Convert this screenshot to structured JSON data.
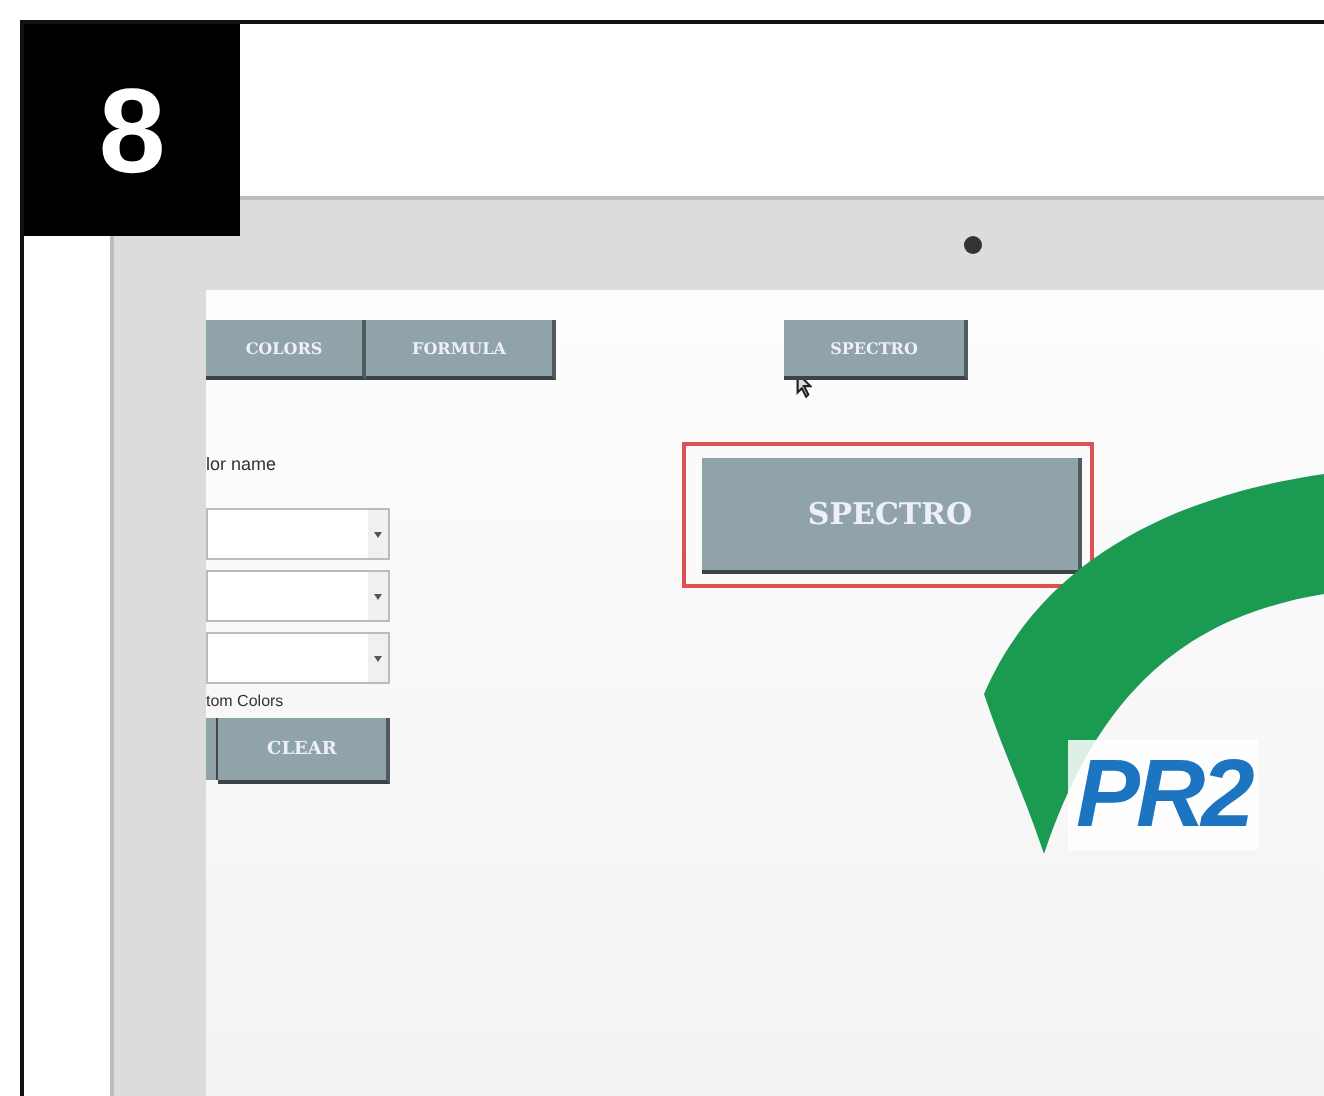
{
  "step_badge": "8",
  "tabs": [
    {
      "label": "COLORS"
    },
    {
      "label": "FORMULA"
    }
  ],
  "top_button": "SPECTRO",
  "color_name_label": "lor name",
  "dropdowns": [
    {
      "kind": "select"
    },
    {
      "kind": "select"
    },
    {
      "kind": "select"
    }
  ],
  "custom_colors_label": "tom Colors",
  "clear_button": "CLEAR",
  "spectro_button": {
    "label": "SPECTRO",
    "highlighted": true
  },
  "logo_text": "PR2"
}
